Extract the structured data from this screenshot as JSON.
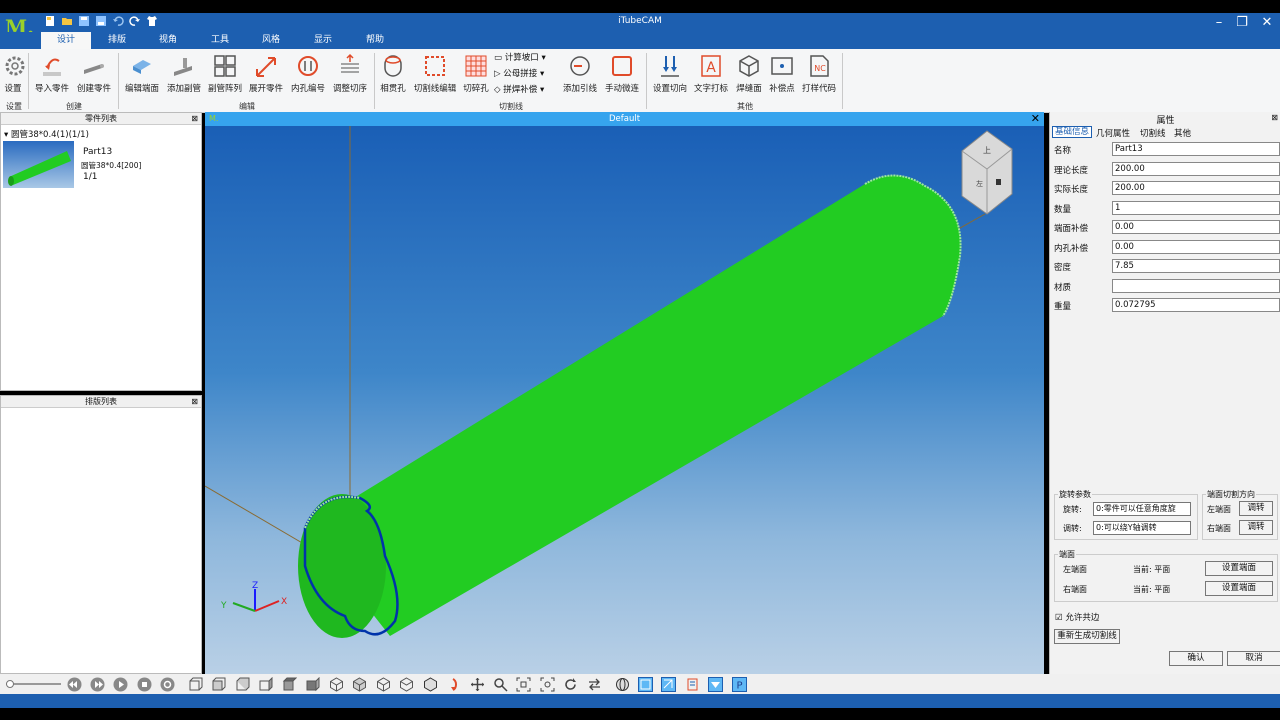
{
  "app": {
    "title": "iTubeCAM"
  },
  "menu": [
    "设计",
    "排版",
    "视角",
    "工具",
    "风格",
    "显示",
    "帮助"
  ],
  "ribbon": {
    "buttons": [
      "设置",
      "导入零件",
      "创建零件",
      "编辑端面",
      "添加副管",
      "副管阵列",
      "展开零件",
      "内孔编号",
      "调整切序",
      "相贯孔",
      "切割线编辑",
      "切碎孔",
      "添加引线",
      "手动微连",
      "设置切向",
      "文字打标",
      "焊缝面",
      "补偿点",
      "打样代码"
    ],
    "small": [
      "计算坡口",
      "公母拼接",
      "拼焊补偿"
    ],
    "groups": [
      "设置",
      "创建",
      "编辑",
      "切割线",
      "其他"
    ]
  },
  "parts_panel": {
    "title": "零件列表",
    "tree_label": "圆管38*0.4(1)(1/1)",
    "part_name": "Part13",
    "part_spec": "圆管38*0.4[200]",
    "part_count": "1/1"
  },
  "layout_panel": {
    "title": "排版列表"
  },
  "viewport": {
    "title": "Default"
  },
  "properties": {
    "title": "属性",
    "tabs": [
      "基础信息",
      "几何属性",
      "切割线",
      "其他"
    ],
    "rows": [
      {
        "label": "名称",
        "value": "Part13"
      },
      {
        "label": "理论长度",
        "value": "200.00"
      },
      {
        "label": "实际长度",
        "value": "200.00"
      },
      {
        "label": "数量",
        "value": "1"
      },
      {
        "label": "端面补偿",
        "value": "0.00"
      },
      {
        "label": "内孔补偿",
        "value": "0.00"
      },
      {
        "label": "密度",
        "value": "7.85"
      },
      {
        "label": "材质",
        "value": ""
      },
      {
        "label": "重量",
        "value": "0.072795"
      }
    ],
    "rotation": {
      "title": "旋转参数",
      "rotate_label": "旋转:",
      "rotate_value": "0:零件可以任意角度旋",
      "flip_label": "调转:",
      "flip_value": "0:可以绕Y轴调转"
    },
    "cut_dir": {
      "title": "端面切割方向",
      "left_label": "左端面",
      "right_label": "右端面",
      "button": "调转"
    },
    "ends": {
      "title": "端面",
      "left_label": "左端面",
      "right_label": "右端面",
      "current": "当前: 平面",
      "button": "设置端面"
    },
    "allow_common_edge": "允许共边",
    "regen_button": "重新生成切割线",
    "ok_button": "确认",
    "cancel_button": "取消"
  },
  "colors": {
    "accent": "#1d5fb0",
    "viewport_head": "#36a4ee",
    "tube": "#22cc22"
  }
}
